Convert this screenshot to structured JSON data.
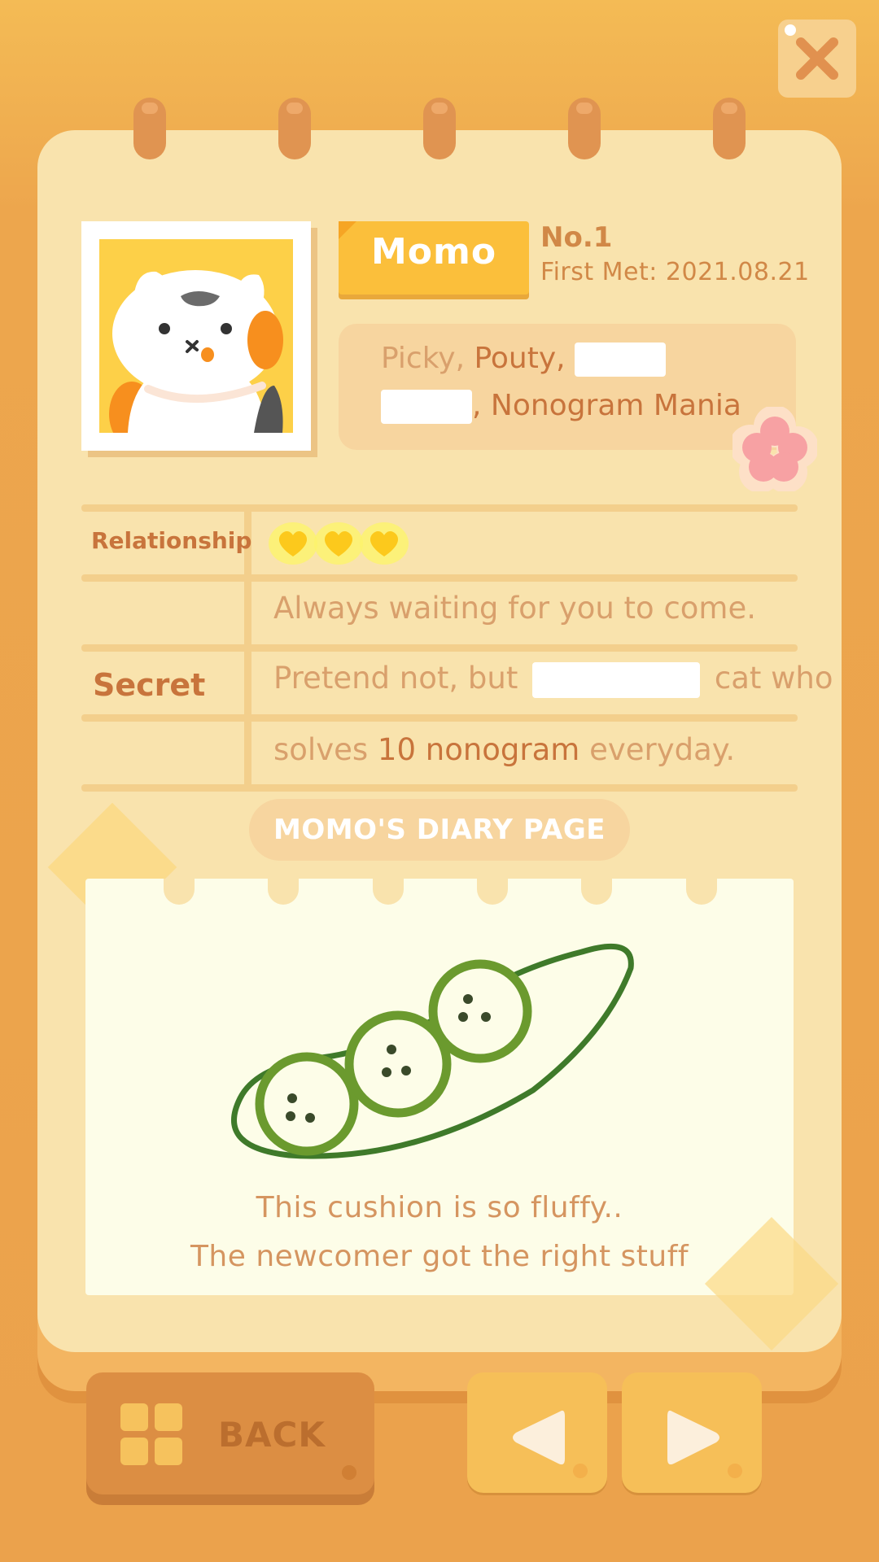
{
  "close_button": {
    "icon": "close-icon"
  },
  "profile": {
    "name": "Momo",
    "number": "No.1",
    "first_met": "First Met: 2021.08.21",
    "traits": {
      "line1_prefix": "Picky, ",
      "line1_bold": "Pouty",
      "line1_comma": ",",
      "line2_suffix": ", Nonogram Mania"
    }
  },
  "table": {
    "relationship_label": "Relationship",
    "relationship_hearts": 3,
    "row1_text": "Always waiting for you to come.",
    "secret_label": "Secret",
    "row2_before": "Pretend not, but",
    "row2_after": "cat who",
    "row3_before": "solves ",
    "row3_bold": "10 nonogram",
    "row3_after": " everyday."
  },
  "diary": {
    "title": "MOMO'S DIARY PAGE",
    "line1": "This cushion is so fluffy..",
    "line2": "The newcomer got the right stuff"
  },
  "nav": {
    "back_label": "BACK",
    "prev_icon": "arrow-left-icon",
    "next_icon": "arrow-right-icon"
  },
  "colors": {
    "background": "#eda64d",
    "page": "#f9e3ad",
    "name_tag": "#fbbf3b",
    "heart": "#fde047",
    "accent_text": "#c8743c"
  }
}
